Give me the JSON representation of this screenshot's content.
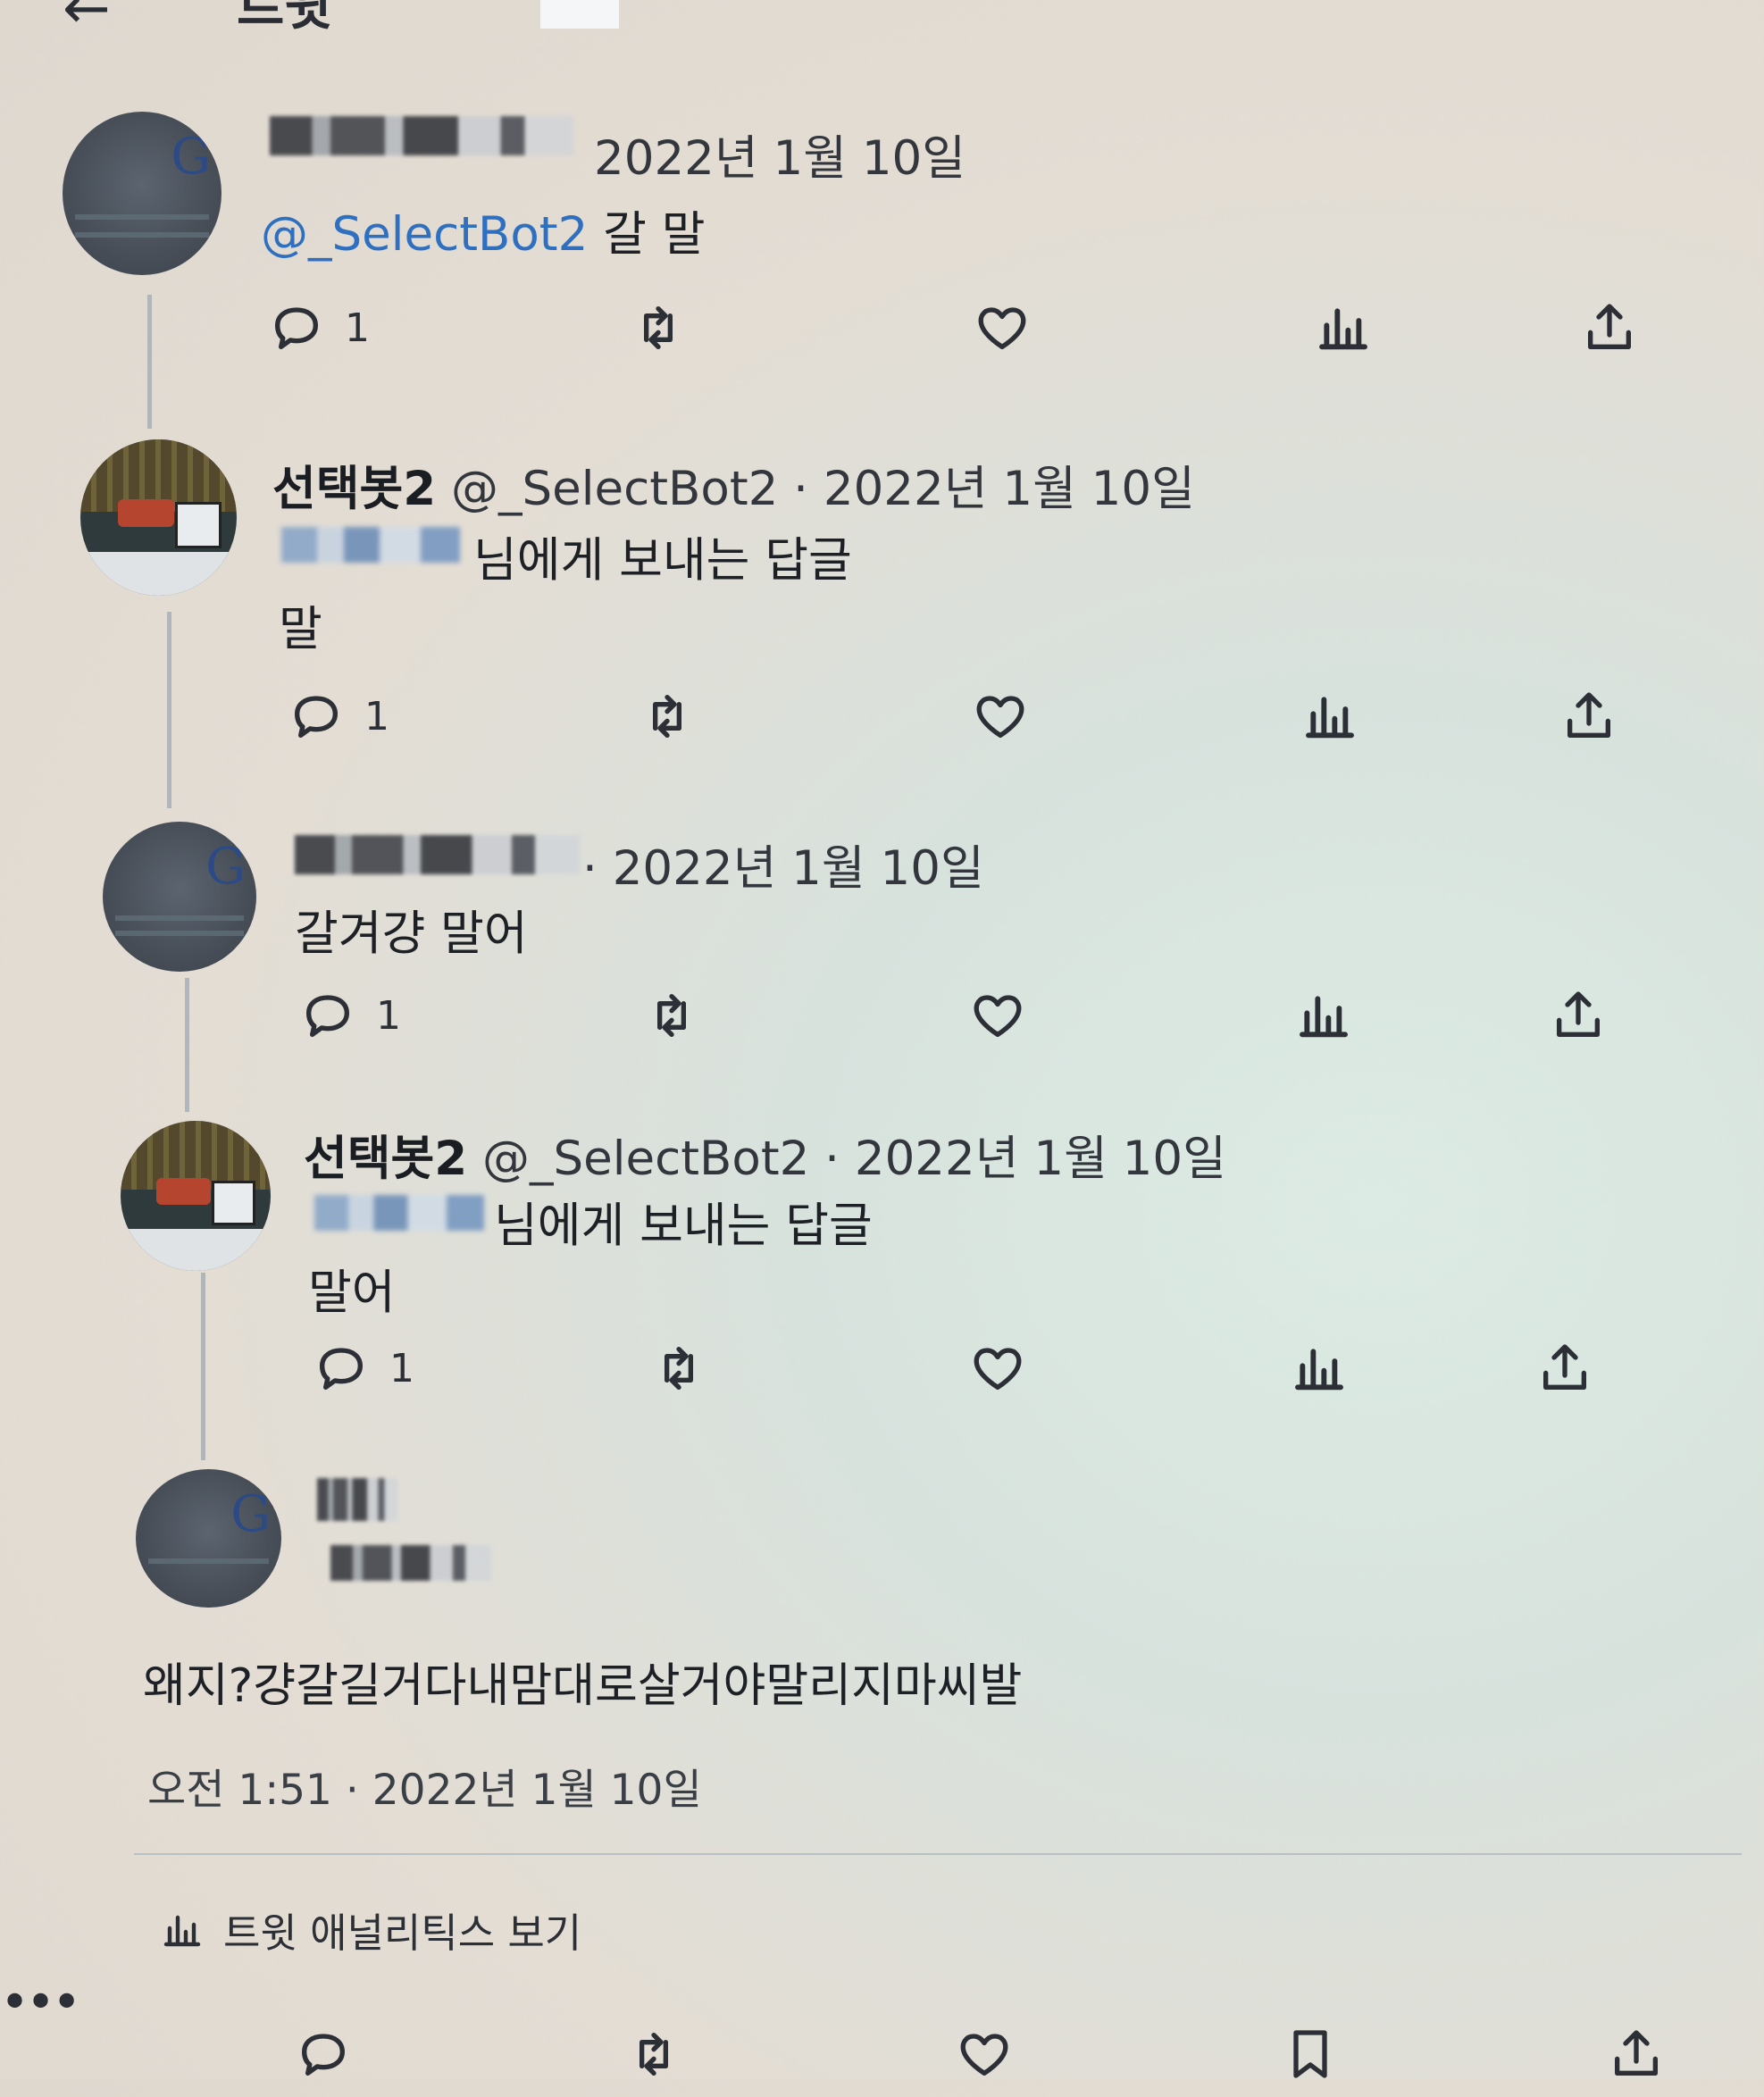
{
  "header": {
    "title": "트윗"
  },
  "tweets": [
    {
      "handle": "",
      "meta": "2022년 1월 10일",
      "mention": "@_SelectBot2",
      "text": "갈 말",
      "reply_count": "1"
    },
    {
      "display_name": "선택봇2",
      "handle_meta": "@_SelectBot2 · 2022년 1월 10일",
      "reply_to": "님에게 보내는 답글",
      "text": "말",
      "reply_count": "1"
    },
    {
      "meta": "· 2022년 1월 10일",
      "text": "갈겨걍 말어",
      "reply_count": "1"
    },
    {
      "display_name": "선택봇2",
      "handle_meta": "@_SelectBot2 · 2022년 1월 10일",
      "reply_to": "님에게 보내는 답글",
      "text": "말어",
      "reply_count": "1"
    }
  ],
  "main_tweet": {
    "text": "왜지?걍갈길거다내맘대로살거야말리지마씨발",
    "timestamp": "오전 1:51 · 2022년 1월 10일",
    "analytics_label": "트윗 애널리틱스 보기"
  },
  "icons": [
    "reply-icon",
    "retweet-icon",
    "like-icon",
    "views-icon",
    "share-icon",
    "bookmark-icon"
  ],
  "colors": {
    "mention": "#2f6fc0",
    "text": "#1d2025"
  }
}
